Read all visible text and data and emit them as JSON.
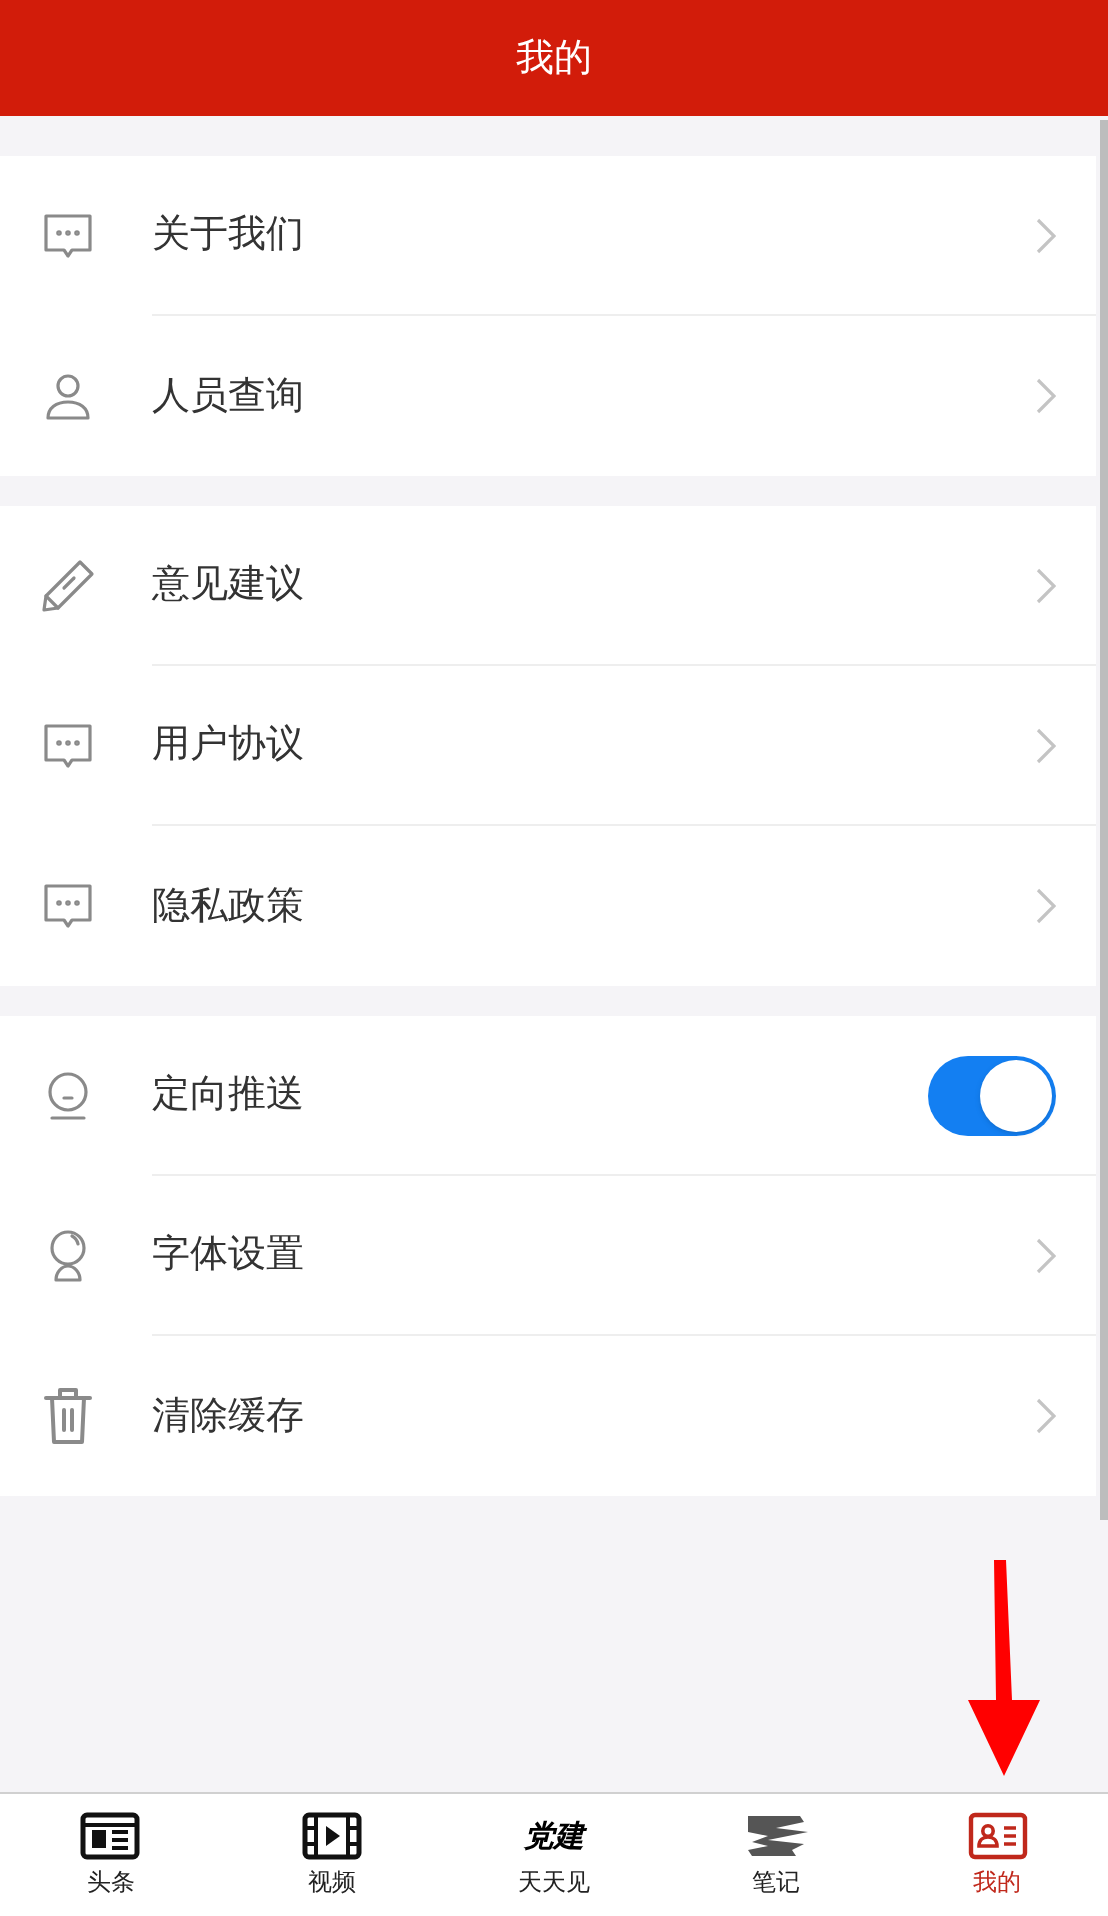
{
  "header": {
    "title": "我的"
  },
  "groups": [
    {
      "items": [
        {
          "label": "关于我们",
          "kind": "link"
        },
        {
          "label": "人员查询",
          "kind": "link"
        }
      ]
    },
    {
      "items": [
        {
          "label": "意见建议",
          "kind": "link"
        },
        {
          "label": "用户协议",
          "kind": "link"
        },
        {
          "label": "隐私政策",
          "kind": "link"
        }
      ]
    },
    {
      "items": [
        {
          "label": "定向推送",
          "kind": "toggle",
          "on": true
        },
        {
          "label": "字体设置",
          "kind": "link"
        },
        {
          "label": "清除缓存",
          "kind": "link"
        }
      ]
    }
  ],
  "tabbar": [
    {
      "label": "头条",
      "selected": false
    },
    {
      "label": "视频",
      "selected": false
    },
    {
      "label": "天天见",
      "logo_text": "党建",
      "selected": false
    },
    {
      "label": "笔记",
      "selected": false
    },
    {
      "label": "我的",
      "selected": true
    }
  ]
}
